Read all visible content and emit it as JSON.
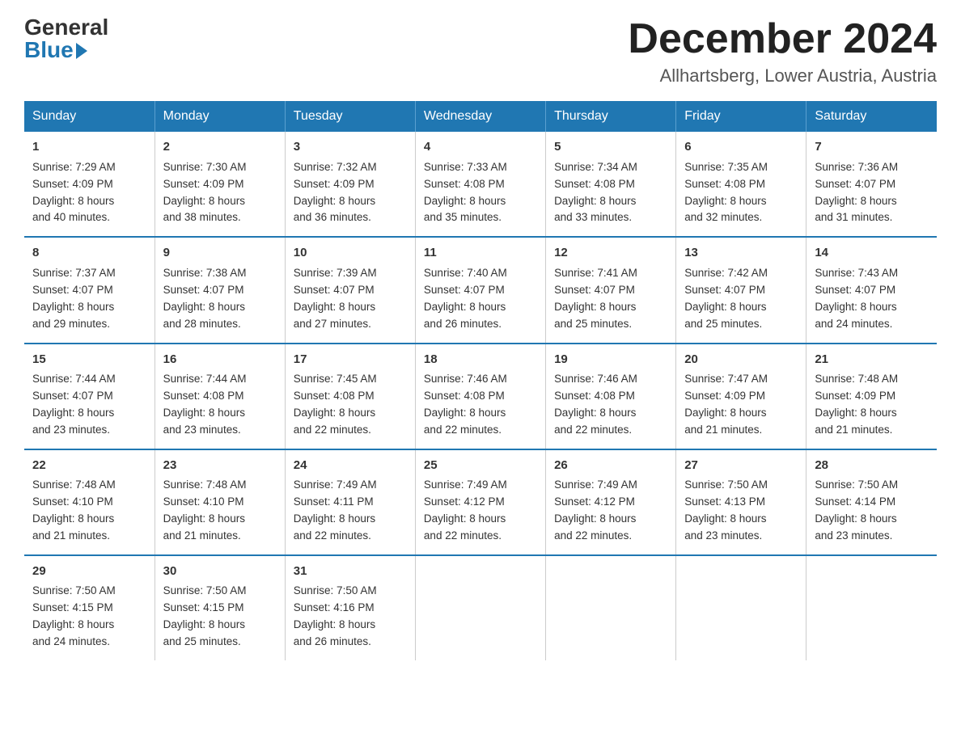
{
  "header": {
    "logo_general": "General",
    "logo_blue": "Blue",
    "month_title": "December 2024",
    "location": "Allhartsberg, Lower Austria, Austria"
  },
  "weekdays": [
    "Sunday",
    "Monday",
    "Tuesday",
    "Wednesday",
    "Thursday",
    "Friday",
    "Saturday"
  ],
  "weeks": [
    [
      {
        "day": "1",
        "sunrise": "7:29 AM",
        "sunset": "4:09 PM",
        "daylight": "8 hours and 40 minutes."
      },
      {
        "day": "2",
        "sunrise": "7:30 AM",
        "sunset": "4:09 PM",
        "daylight": "8 hours and 38 minutes."
      },
      {
        "day": "3",
        "sunrise": "7:32 AM",
        "sunset": "4:09 PM",
        "daylight": "8 hours and 36 minutes."
      },
      {
        "day": "4",
        "sunrise": "7:33 AM",
        "sunset": "4:08 PM",
        "daylight": "8 hours and 35 minutes."
      },
      {
        "day": "5",
        "sunrise": "7:34 AM",
        "sunset": "4:08 PM",
        "daylight": "8 hours and 33 minutes."
      },
      {
        "day": "6",
        "sunrise": "7:35 AM",
        "sunset": "4:08 PM",
        "daylight": "8 hours and 32 minutes."
      },
      {
        "day": "7",
        "sunrise": "7:36 AM",
        "sunset": "4:07 PM",
        "daylight": "8 hours and 31 minutes."
      }
    ],
    [
      {
        "day": "8",
        "sunrise": "7:37 AM",
        "sunset": "4:07 PM",
        "daylight": "8 hours and 29 minutes."
      },
      {
        "day": "9",
        "sunrise": "7:38 AM",
        "sunset": "4:07 PM",
        "daylight": "8 hours and 28 minutes."
      },
      {
        "day": "10",
        "sunrise": "7:39 AM",
        "sunset": "4:07 PM",
        "daylight": "8 hours and 27 minutes."
      },
      {
        "day": "11",
        "sunrise": "7:40 AM",
        "sunset": "4:07 PM",
        "daylight": "8 hours and 26 minutes."
      },
      {
        "day": "12",
        "sunrise": "7:41 AM",
        "sunset": "4:07 PM",
        "daylight": "8 hours and 25 minutes."
      },
      {
        "day": "13",
        "sunrise": "7:42 AM",
        "sunset": "4:07 PM",
        "daylight": "8 hours and 25 minutes."
      },
      {
        "day": "14",
        "sunrise": "7:43 AM",
        "sunset": "4:07 PM",
        "daylight": "8 hours and 24 minutes."
      }
    ],
    [
      {
        "day": "15",
        "sunrise": "7:44 AM",
        "sunset": "4:07 PM",
        "daylight": "8 hours and 23 minutes."
      },
      {
        "day": "16",
        "sunrise": "7:44 AM",
        "sunset": "4:08 PM",
        "daylight": "8 hours and 23 minutes."
      },
      {
        "day": "17",
        "sunrise": "7:45 AM",
        "sunset": "4:08 PM",
        "daylight": "8 hours and 22 minutes."
      },
      {
        "day": "18",
        "sunrise": "7:46 AM",
        "sunset": "4:08 PM",
        "daylight": "8 hours and 22 minutes."
      },
      {
        "day": "19",
        "sunrise": "7:46 AM",
        "sunset": "4:08 PM",
        "daylight": "8 hours and 22 minutes."
      },
      {
        "day": "20",
        "sunrise": "7:47 AM",
        "sunset": "4:09 PM",
        "daylight": "8 hours and 21 minutes."
      },
      {
        "day": "21",
        "sunrise": "7:48 AM",
        "sunset": "4:09 PM",
        "daylight": "8 hours and 21 minutes."
      }
    ],
    [
      {
        "day": "22",
        "sunrise": "7:48 AM",
        "sunset": "4:10 PM",
        "daylight": "8 hours and 21 minutes."
      },
      {
        "day": "23",
        "sunrise": "7:48 AM",
        "sunset": "4:10 PM",
        "daylight": "8 hours and 21 minutes."
      },
      {
        "day": "24",
        "sunrise": "7:49 AM",
        "sunset": "4:11 PM",
        "daylight": "8 hours and 22 minutes."
      },
      {
        "day": "25",
        "sunrise": "7:49 AM",
        "sunset": "4:12 PM",
        "daylight": "8 hours and 22 minutes."
      },
      {
        "day": "26",
        "sunrise": "7:49 AM",
        "sunset": "4:12 PM",
        "daylight": "8 hours and 22 minutes."
      },
      {
        "day": "27",
        "sunrise": "7:50 AM",
        "sunset": "4:13 PM",
        "daylight": "8 hours and 23 minutes."
      },
      {
        "day": "28",
        "sunrise": "7:50 AM",
        "sunset": "4:14 PM",
        "daylight": "8 hours and 23 minutes."
      }
    ],
    [
      {
        "day": "29",
        "sunrise": "7:50 AM",
        "sunset": "4:15 PM",
        "daylight": "8 hours and 24 minutes."
      },
      {
        "day": "30",
        "sunrise": "7:50 AM",
        "sunset": "4:15 PM",
        "daylight": "8 hours and 25 minutes."
      },
      {
        "day": "31",
        "sunrise": "7:50 AM",
        "sunset": "4:16 PM",
        "daylight": "8 hours and 26 minutes."
      },
      null,
      null,
      null,
      null
    ]
  ],
  "labels": {
    "sunrise": "Sunrise:",
    "sunset": "Sunset:",
    "daylight": "Daylight:"
  }
}
